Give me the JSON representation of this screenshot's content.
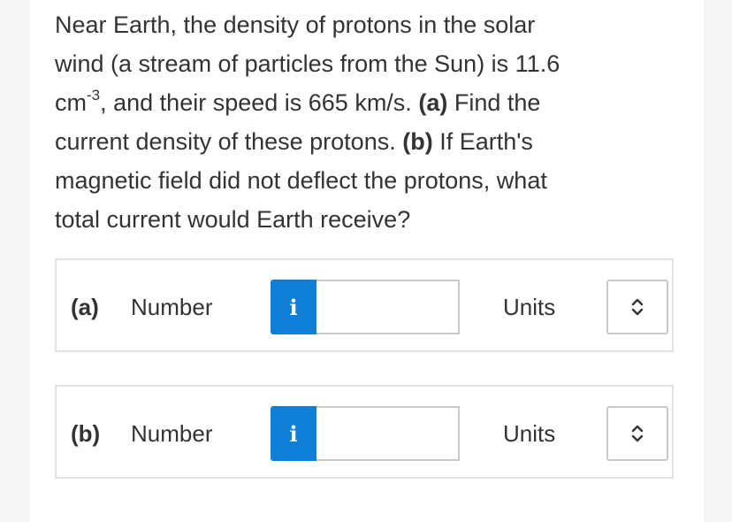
{
  "question": {
    "line1": "Near Earth, the density of protons in the solar",
    "line2": "wind (a stream of particles from the Sun) is 11.6",
    "line3_unit": "cm",
    "line3_exp": "-3",
    "line3_rest": ", and their speed is 665 km/s. ",
    "part_a_tag": "(a)",
    "line3_tail": " Find the",
    "line4": "current density of these protons. ",
    "part_b_tag": "(b)",
    "line4_tail": " If Earth's",
    "line5": "magnetic field did not deflect the protons, what",
    "line6": "total current would Earth receive?"
  },
  "answers": [
    {
      "part": "(a)",
      "number_label": "Number",
      "info_icon": "i",
      "value": "",
      "units_label": "Units",
      "units_selected": ""
    },
    {
      "part": "(b)",
      "number_label": "Number",
      "info_icon": "i",
      "value": "",
      "units_label": "Units",
      "units_selected": ""
    }
  ],
  "colors": {
    "info_button": "#0f7fd8",
    "border": "#e2e2e2",
    "text": "#333333"
  }
}
